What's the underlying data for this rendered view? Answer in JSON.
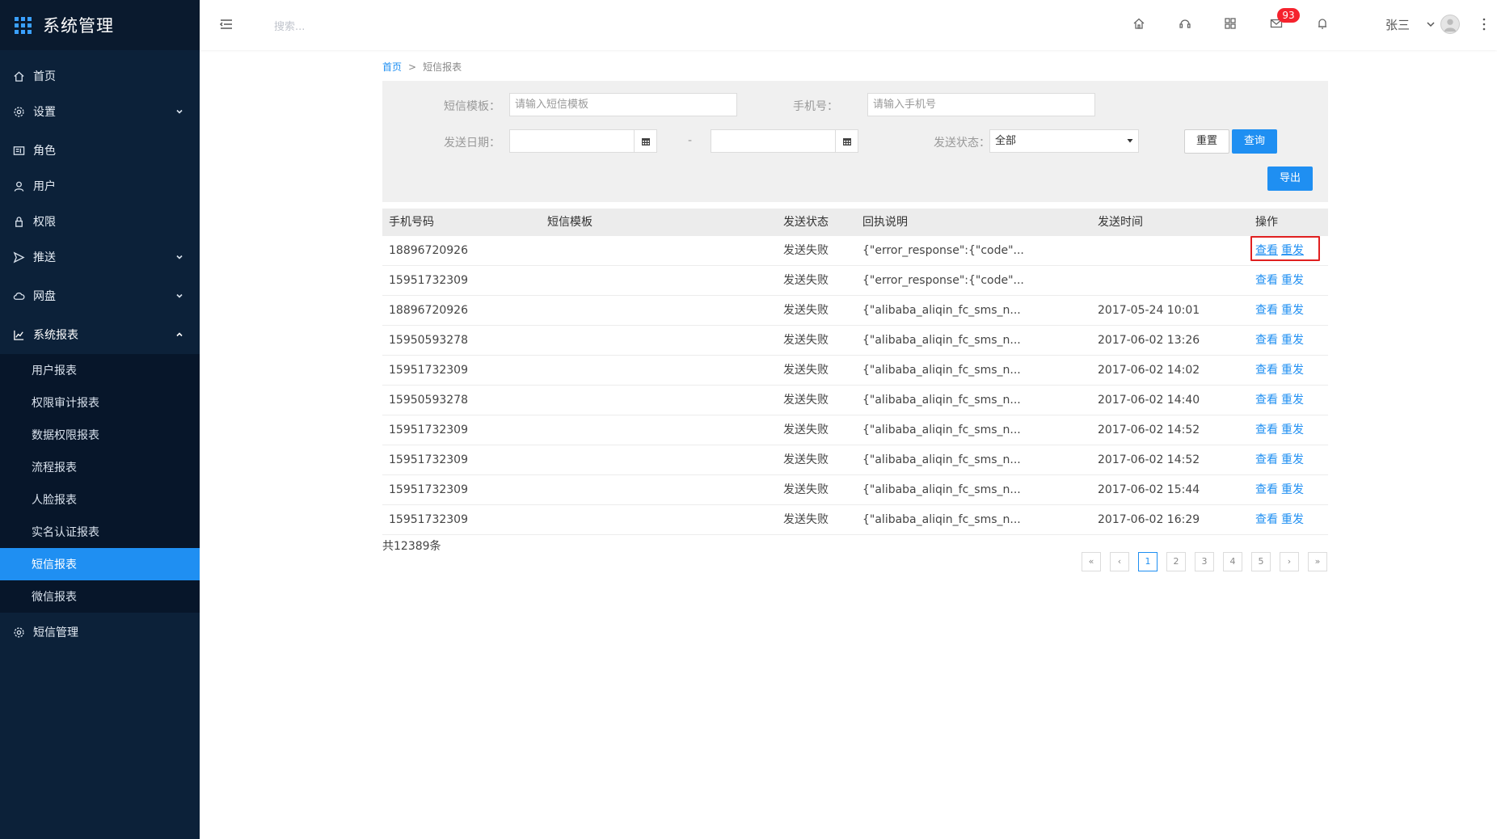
{
  "app": {
    "title": "系统管理"
  },
  "sidebar": {
    "items": [
      {
        "label": "首页",
        "icon": "home-icon"
      },
      {
        "label": "设置",
        "icon": "gear-icon"
      },
      {
        "label": "角色",
        "icon": "id-card-icon"
      },
      {
        "label": "用户",
        "icon": "user-icon"
      },
      {
        "label": "权限",
        "icon": "lock-icon"
      },
      {
        "label": "推送",
        "icon": "send-icon"
      },
      {
        "label": "网盘",
        "icon": "cloud-icon"
      },
      {
        "label": "系统报表",
        "icon": "chart-icon"
      }
    ],
    "sub_items": [
      {
        "label": "用户报表"
      },
      {
        "label": "权限审计报表"
      },
      {
        "label": "数据权限报表"
      },
      {
        "label": "流程报表"
      },
      {
        "label": "人脸报表"
      },
      {
        "label": "实名认证报表"
      },
      {
        "label": "短信报表"
      },
      {
        "label": "微信报表"
      }
    ],
    "last_item": {
      "label": "短信管理",
      "icon": "gear-icon"
    }
  },
  "header": {
    "search_placeholder": "搜索...",
    "mail_badge": "93",
    "user_name": "张三"
  },
  "breadcrumb": {
    "home": "首页",
    "separator": ">",
    "current": "短信报表"
  },
  "filters": {
    "template_label": "短信模板：",
    "template_placeholder": "请输入短信模板",
    "phone_label": "手机号：",
    "phone_placeholder": "请输入手机号",
    "date_label": "发送日期：",
    "date_separator": "-",
    "status_label": "发送状态：",
    "status_value": "全部",
    "reset_label": "重置",
    "search_label": "查询",
    "export_label": "导出"
  },
  "table": {
    "columns": [
      "手机号码",
      "短信模板",
      "发送状态",
      "回执说明",
      "发送时间",
      "操作"
    ],
    "view_label": "查看",
    "resend_label": "重发",
    "rows": [
      {
        "phone": "18896720926",
        "template": "",
        "status": "发送失败",
        "receipt": "{\"error_response\":{\"code\"...",
        "time": ""
      },
      {
        "phone": "15951732309",
        "template": "",
        "status": "发送失败",
        "receipt": "{\"error_response\":{\"code\"...",
        "time": ""
      },
      {
        "phone": "18896720926",
        "template": "",
        "status": "发送失败",
        "receipt": "{\"alibaba_aliqin_fc_sms_n...",
        "time": "2017-05-24 10:01"
      },
      {
        "phone": "15950593278",
        "template": "",
        "status": "发送失败",
        "receipt": "{\"alibaba_aliqin_fc_sms_n...",
        "time": "2017-06-02 13:26"
      },
      {
        "phone": "15951732309",
        "template": "",
        "status": "发送失败",
        "receipt": "{\"alibaba_aliqin_fc_sms_n...",
        "time": "2017-06-02 14:02"
      },
      {
        "phone": "15950593278",
        "template": "",
        "status": "发送失败",
        "receipt": "{\"alibaba_aliqin_fc_sms_n...",
        "time": "2017-06-02 14:40"
      },
      {
        "phone": "15951732309",
        "template": "",
        "status": "发送失败",
        "receipt": "{\"alibaba_aliqin_fc_sms_n...",
        "time": "2017-06-02 14:52"
      },
      {
        "phone": "15951732309",
        "template": "",
        "status": "发送失败",
        "receipt": "{\"alibaba_aliqin_fc_sms_n...",
        "time": "2017-06-02 14:52"
      },
      {
        "phone": "15951732309",
        "template": "",
        "status": "发送失败",
        "receipt": "{\"alibaba_aliqin_fc_sms_n...",
        "time": "2017-06-02 15:44"
      },
      {
        "phone": "15951732309",
        "template": "",
        "status": "发送失败",
        "receipt": "{\"alibaba_aliqin_fc_sms_n...",
        "time": "2017-06-02 16:29"
      }
    ]
  },
  "total_text": "共12389条",
  "pagination": {
    "first": "«",
    "prev": "‹",
    "pages": [
      "1",
      "2",
      "3",
      "4",
      "5"
    ],
    "active_page": "1",
    "next": "›",
    "last": "»"
  },
  "colors": {
    "sidebar_bg": "#0c2139",
    "accent": "#1f8ff2",
    "badge": "#f5222d",
    "highlight": "#e02020"
  }
}
